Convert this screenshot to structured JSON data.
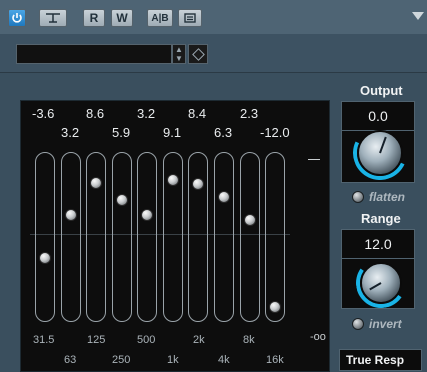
{
  "toolbar": {
    "power_icon": "power-icon",
    "bypass_icon": "bypass-icon",
    "read_label": "R",
    "write_label": "W",
    "ab_label": "A|B",
    "preset_menu_icon": "menu-icon",
    "dropdown_icon": "triangle-down-icon",
    "accent_color": "#1f78bd"
  },
  "preset": {
    "value": "",
    "spin_icon": "up-down-arrows-icon",
    "options_icon": "diamond-icon"
  },
  "eq": {
    "bands": [
      {
        "freq": "31.5",
        "gain": "-3.6",
        "level": 0.35
      },
      {
        "freq": "63",
        "gain": "3.2",
        "level": 0.65
      },
      {
        "freq": "125",
        "gain": "8.6",
        "level": 0.88
      },
      {
        "freq": "250",
        "gain": "5.9",
        "level": 0.76
      },
      {
        "freq": "500",
        "gain": "3.2",
        "level": 0.65
      },
      {
        "freq": "1k",
        "gain": "9.1",
        "level": 0.9
      },
      {
        "freq": "2k",
        "gain": "8.4",
        "level": 0.87
      },
      {
        "freq": "4k",
        "gain": "6.3",
        "level": 0.78
      },
      {
        "freq": "8k",
        "gain": "2.3",
        "level": 0.62
      },
      {
        "freq": "16k",
        "gain": "-12.0",
        "level": 0.0
      }
    ],
    "scale_min_label": "-oo"
  },
  "output": {
    "label": "Output",
    "value": "0.0",
    "flatten_label": "flatten"
  },
  "range": {
    "label": "Range",
    "value": "12.0",
    "invert_label": "invert"
  },
  "mode": {
    "value": "True Resp"
  }
}
